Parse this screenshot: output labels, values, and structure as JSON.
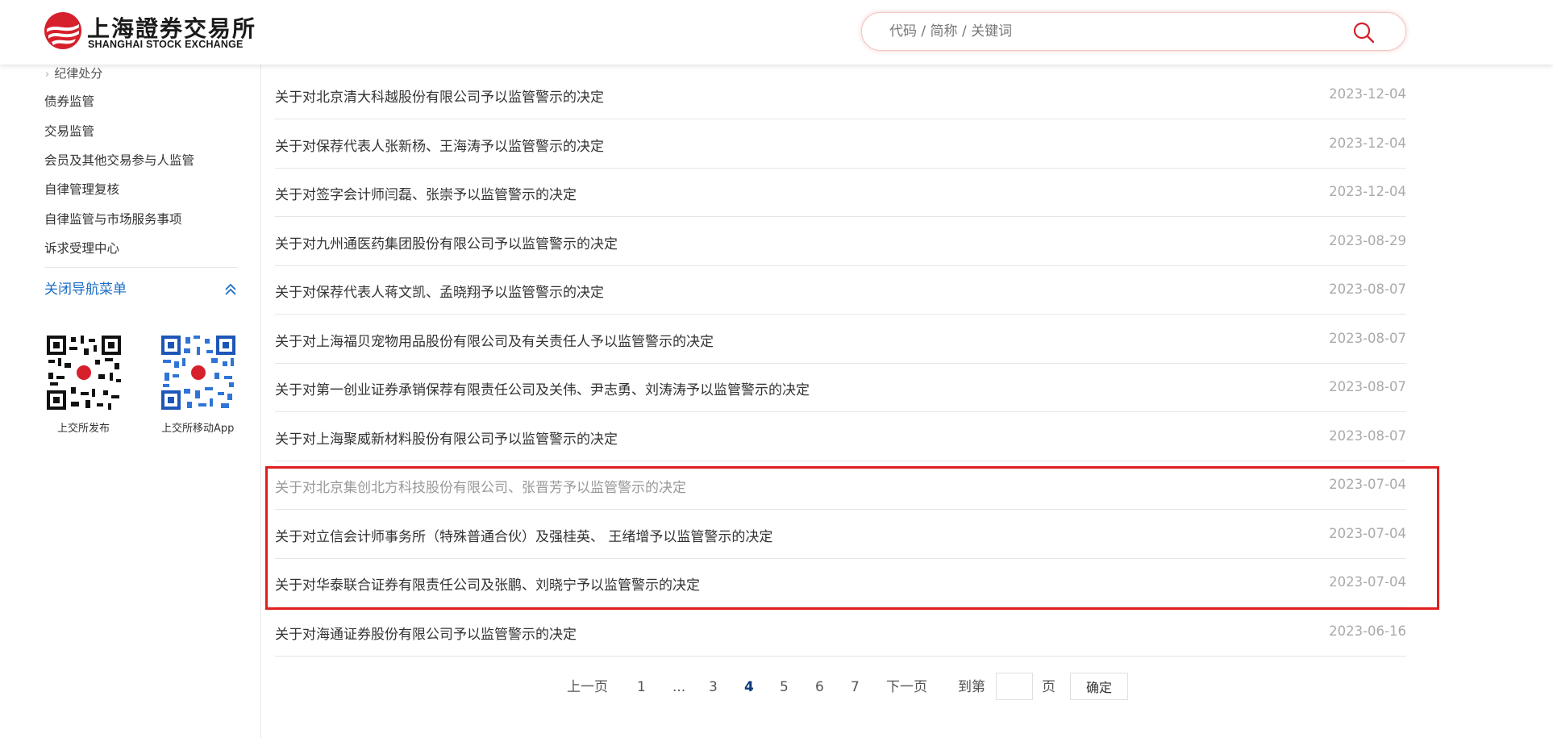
{
  "header": {
    "logo_cn": "上海證券交易所",
    "logo_en": "SHANGHAI STOCK EXCHANGE",
    "search_placeholder": "代码 / 简称 / 关键词"
  },
  "sidebar": {
    "sub_item": "纪律处分",
    "items": [
      {
        "label": "债券监管"
      },
      {
        "label": "交易监管"
      },
      {
        "label": "会员及其他交易参与人监管"
      },
      {
        "label": "自律管理复核"
      },
      {
        "label": "自律监管与市场服务事项"
      },
      {
        "label": "诉求受理中心"
      }
    ],
    "close_nav": "关闭导航菜单",
    "qr": [
      {
        "label": "上交所发布"
      },
      {
        "label": "上交所移动App"
      }
    ]
  },
  "list": {
    "rows": [
      {
        "title": "关于对北京清大科越股份有限公司予以监管警示的决定",
        "date": "2023-12-04"
      },
      {
        "title": "关于对保荐代表人张新杨、王海涛予以监管警示的决定",
        "date": "2023-12-04"
      },
      {
        "title": "关于对签字会计师闫磊、张崇予以监管警示的决定",
        "date": "2023-12-04"
      },
      {
        "title": "关于对九州通医药集团股份有限公司予以监管警示的决定",
        "date": "2023-08-29"
      },
      {
        "title": "关于对保荐代表人蒋文凯、孟晓翔予以监管警示的决定",
        "date": "2023-08-07"
      },
      {
        "title": "关于对上海福贝宠物用品股份有限公司及有关责任人予以监管警示的决定",
        "date": "2023-08-07"
      },
      {
        "title": "关于对第一创业证券承销保荐有限责任公司及关伟、尹志勇、刘涛涛予以监管警示的决定",
        "date": "2023-08-07"
      },
      {
        "title": "关于对上海聚威新材料股份有限公司予以监管警示的决定",
        "date": "2023-08-07"
      },
      {
        "title": "关于对北京集创北方科技股份有限公司、张晋芳予以监管警示的决定",
        "date": "2023-07-04"
      },
      {
        "title": "关于对立信会计师事务所（特殊普通合伙）及强桂英、 王绪增予以监管警示的决定",
        "date": "2023-07-04"
      },
      {
        "title": "关于对华泰联合证券有限责任公司及张鹏、刘晓宁予以监管警示的决定",
        "date": "2023-07-04"
      },
      {
        "title": "关于对海通证券股份有限公司予以监管警示的决定",
        "date": "2023-06-16"
      }
    ]
  },
  "pagination": {
    "prev": "上一页",
    "pages": [
      "1",
      "...",
      "3",
      "4",
      "5",
      "6",
      "7"
    ],
    "current": "4",
    "next": "下一页",
    "goto_prefix": "到第",
    "goto_suffix": "页",
    "confirm": "确定"
  },
  "colors": {
    "accent_blue": "#1d6fc4",
    "current_page": "#0b3a78",
    "highlight_red": "#e01f1f",
    "logo_red": "#d6202b"
  }
}
